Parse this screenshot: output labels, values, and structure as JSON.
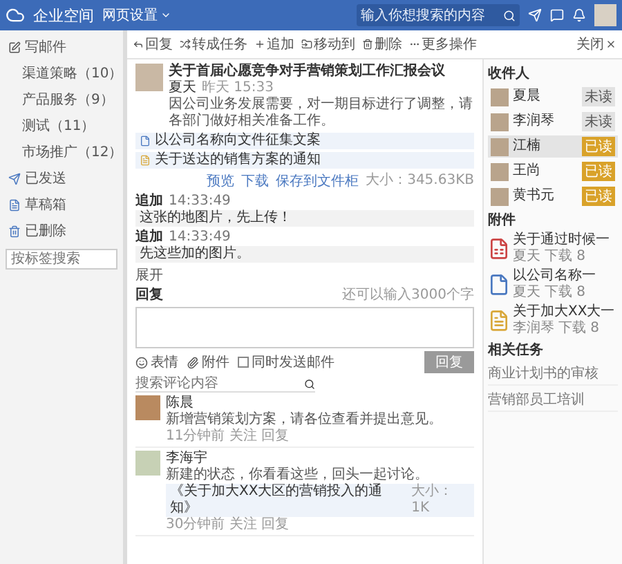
{
  "topbar": {
    "logo": "企业空间",
    "space": "网页设置",
    "search": {
      "placeholder": "输入你想搜索的内容"
    }
  },
  "sidebar": {
    "compose": "写邮件",
    "folders": [
      {
        "label": "渠道策略（10）",
        "selected": false
      },
      {
        "label": "产品服务（9）",
        "selected": false
      },
      {
        "label": "测试（11）",
        "selected": false
      },
      {
        "label": "市场推广（12）",
        "selected": false
      }
    ],
    "boxes": [
      {
        "kind": "sent",
        "label": "已发送"
      },
      {
        "kind": "draft",
        "label": "草稿箱"
      },
      {
        "kind": "trash",
        "label": "已删除"
      }
    ],
    "tag_search": {
      "placeholder": "按标签搜索"
    }
  },
  "toolbar": {
    "actions": [
      {
        "kind": "reply",
        "label": "回复"
      },
      {
        "kind": "task",
        "label": "转成任务"
      },
      {
        "kind": "append",
        "label": "追加"
      },
      {
        "kind": "move",
        "label": "移动到"
      },
      {
        "kind": "delete",
        "label": "删除"
      },
      {
        "kind": "more",
        "label": "更多操作"
      }
    ],
    "close": "关闭"
  },
  "message": {
    "title": "关于首届心愿竞争对手营销策划工作汇报会议",
    "sender": "夏天",
    "time": "昨天 15:33",
    "body": "因公司业务发展需要，对一期目标进行了调整，请各部门做好相关准备工作。",
    "attachments": [
      {
        "name": "以公司名称向文件征集文案",
        "kind": "pdf"
      },
      {
        "name": "关于送达的销售方案的通知",
        "kind": "doc"
      }
    ],
    "attachment_actions": [
      "预览",
      "下载",
      "保存到文件柜"
    ],
    "size": "大小：345.63KB",
    "appends": [
      {
        "label": "追加",
        "time": "14:33:49",
        "text": "这张的地图片，先上传！"
      },
      {
        "label": "追加",
        "time": "14:33:49",
        "text": "先这些加的图片。"
      }
    ],
    "expand": "展开"
  },
  "reply": {
    "label": "回复",
    "hint": "还可以输入3000个字",
    "options": [
      {
        "kind": "emoji",
        "label": "表情"
      },
      {
        "kind": "attach",
        "label": "附件"
      },
      {
        "kind": "check",
        "label": "同时发送邮件",
        "checked": false
      }
    ],
    "submit": "回复"
  },
  "comments": {
    "search": {
      "placeholder": "搜索评论内容"
    },
    "items": [
      {
        "author": "陈晨",
        "text": "新增营销策划方案，请各位查看并提出意见。",
        "meta": "11分钟前 关注 回复"
      },
      {
        "author": "李海宇",
        "text": "新建的状态，你看看这些，回头一起讨论。",
        "quote": "《关于加大XX大区的营销投入的通知》",
        "quote_size": "大小：1K",
        "meta": "30分钟前 关注 回复"
      }
    ]
  },
  "recipients": {
    "title": "收件人",
    "items": [
      {
        "name": "夏晨",
        "status": "未读",
        "read": false,
        "selected": false
      },
      {
        "name": "李润琴",
        "status": "未读",
        "read": false,
        "selected": false
      },
      {
        "name": "江楠",
        "status": "已读",
        "read": true,
        "selected": true
      },
      {
        "name": "王尚",
        "status": "已读",
        "read": true,
        "selected": false
      },
      {
        "name": "黄书元",
        "status": "已读",
        "read": true,
        "selected": false
      }
    ]
  },
  "files": {
    "title": "附件",
    "items": [
      {
        "kind": "xls",
        "name": "关于通过时候一",
        "owner": "夏天",
        "downloads": "下载 8"
      },
      {
        "kind": "pdf",
        "name": "以公司名称一",
        "owner": "夏天",
        "downloads": "下载 8"
      },
      {
        "kind": "doc",
        "name": "关于加大XX大一",
        "owner": "李润琴",
        "downloads": "下载 8"
      }
    ]
  },
  "tasks": {
    "title": "相关任务",
    "items": [
      "商业计划书的审核",
      "营销部员工培训"
    ]
  }
}
